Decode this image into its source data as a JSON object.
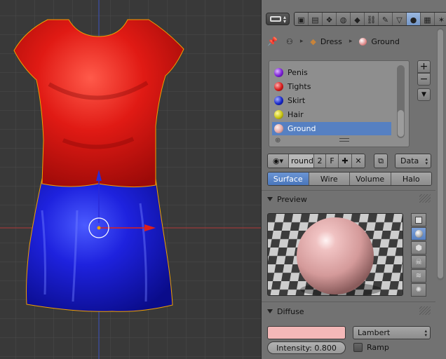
{
  "colors": {
    "viewport_bg": "#393939",
    "panel_bg": "#727272",
    "dress_top": "#e01212",
    "dress_skirt": "#1a1ad8",
    "selection_blue": "#5680c2",
    "ground_diffuse": "#f4b8b8"
  },
  "header": {
    "editor_type_icon": "properties-editor-icon",
    "context_tabs": [
      "render-icon",
      "render-layers-icon",
      "scene-icon",
      "world-icon",
      "object-icon",
      "constraints-icon",
      "modifiers-icon",
      "data-icon",
      "material-icon",
      "texture-icon",
      "particles-icon"
    ],
    "active_context": "material-icon"
  },
  "breadcrumb": {
    "pin_icon": "pin-icon",
    "object_name": "Dress",
    "material_name": "Ground"
  },
  "materials": [
    {
      "name": "Penis",
      "color": "#7b1fd6"
    },
    {
      "name": "Tights",
      "color": "#d61a1a"
    },
    {
      "name": "Skirt",
      "color": "#1626c8"
    },
    {
      "name": "Hair",
      "color": "#c8c412"
    },
    {
      "name": "Ground",
      "color": "#e6a9a6",
      "selected": true
    }
  ],
  "datablock": {
    "name": "round",
    "users": "2",
    "fake_user": "F",
    "link_mode": "Data"
  },
  "type_tabs": [
    {
      "label": "Surface",
      "active": true
    },
    {
      "label": "Wire"
    },
    {
      "label": "Volume"
    },
    {
      "label": "Halo"
    }
  ],
  "sections": {
    "preview": "Preview",
    "diffuse": "Diffuse"
  },
  "diffuse": {
    "shader": "Lambert",
    "intensity_label": "Intensity: 0.800",
    "ramp_label": "Ramp",
    "ramp_checked": false
  },
  "preview_buttons": [
    "flat-preview-icon",
    "sphere-preview-icon",
    "cube-preview-icon",
    "monkey-preview-icon",
    "hair-preview-icon",
    "sky-preview-icon"
  ],
  "active_preview": "sphere-preview-icon"
}
